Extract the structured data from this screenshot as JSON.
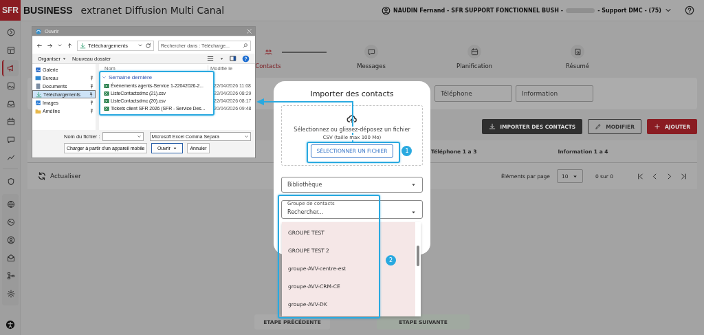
{
  "header": {
    "logo": "SFR",
    "brand": "BUSINESS",
    "title": "extranet Diffusion Multi Canal",
    "user_before": "NAUDIN Fernand - SFR SUPPORT FONCTIONNEL BUSH -",
    "user_after": "- Support DMC - (75)"
  },
  "sidebar": {
    "items": [
      {
        "selected": false
      },
      {
        "selected": false
      },
      {
        "selected": true
      },
      {
        "selected": false
      },
      {
        "selected": false
      },
      {
        "selected": false
      },
      {
        "selected": false
      },
      {
        "selected": false
      },
      {
        "selected": false
      },
      {
        "selected": false
      },
      {
        "selected": false
      },
      {
        "selected": false
      },
      {
        "selected": false
      },
      {
        "selected": false
      },
      {
        "selected": false
      }
    ]
  },
  "stepper": [
    {
      "label": "Contacts",
      "selected": true
    },
    {
      "label": "Messages",
      "selected": false
    },
    {
      "label": "Planification",
      "selected": false
    },
    {
      "label": "Résumé",
      "selected": false
    }
  ],
  "filters": [
    {
      "placeholder": "Téléphone"
    },
    {
      "placeholder": "Information"
    }
  ],
  "actions": [
    {
      "label": "IMPORTER DES CONTACTS",
      "kind": "import"
    },
    {
      "label": "MODIFIER",
      "kind": "edit"
    },
    {
      "label": "AJOUTER",
      "kind": "add"
    }
  ],
  "table": {
    "columns": [
      "Téléphone 1 a 3",
      "Information 1 a 4"
    ]
  },
  "toolbar": {
    "refresh": "Actualiser",
    "per_page_label": "Éléments par page",
    "per_page": "10",
    "range": "0 sur 0"
  },
  "footer": {
    "previous": "ETAPE PRÉCÉDENTE",
    "next": "ETAPE SUIVANTE"
  },
  "modal": {
    "title": "Importer des contacts",
    "drop_text": "Sélectionnez ou glissez-déposez un fichier",
    "drop_hint": "CSV (taille max 100 Mo)",
    "select_button": "SÉLECTIONNER UN FICHIER",
    "library": "Bibliothèque",
    "group_label": "Groupe de contacts",
    "group_placeholder": "Rechercher...",
    "groups": [
      "GROUPE TEST",
      "GROUPE TEST 2",
      "groupe-AVV-centre-est",
      "groupe-AVV-CRM-CE",
      "groupe-AVV-DK"
    ]
  },
  "file_dialog": {
    "title": "Ouvrir",
    "address": "Téléchargements",
    "search_placeholder": "Rechercher dans : Télécharge...",
    "organize": "Organiser",
    "new_folder": "Nouveau dossier",
    "places": [
      {
        "label": "Galerie",
        "selected": false
      },
      {
        "label": "Bureau",
        "selected": false
      },
      {
        "label": "Documents",
        "selected": false
      },
      {
        "label": "Téléchargements",
        "selected": true
      },
      {
        "label": "Images",
        "selected": false
      },
      {
        "label": "Améline",
        "selected": false
      }
    ],
    "columns": [
      "Nom",
      "Modifié le"
    ],
    "group": "Semaine dernière",
    "files": [
      {
        "name": "Évènements agents-Service 1-22042026-2...",
        "modified": "22/04/2026 11:08"
      },
      {
        "name": "ListeContactsdmc (21).csv",
        "modified": "22/04/2026 08:29"
      },
      {
        "name": "ListeContactsdmc (20).csv",
        "modified": "22/04/2026 08:17"
      },
      {
        "name": "Tickets client SFR 2026 (SFR - Service Des...",
        "modified": "20/04/2026 09:48"
      }
    ],
    "filename_label": "Nom du fichier :",
    "filetype": "Microsoft Excel Comma Separa",
    "mobile_button": "Charger à partir d'un appareil mobile",
    "open_button": "Ouvrir",
    "cancel_button": "Annuler"
  },
  "annotations": [
    "1",
    "2"
  ]
}
